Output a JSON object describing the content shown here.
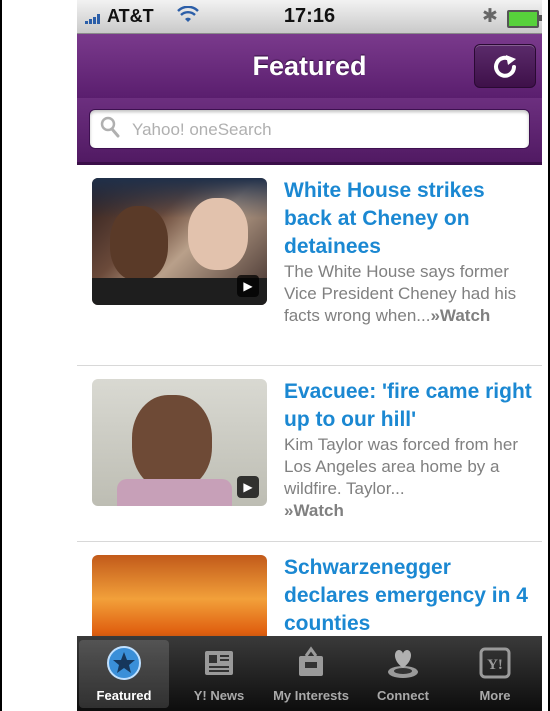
{
  "status_bar": {
    "carrier": "AT&T",
    "time": "17:16"
  },
  "nav": {
    "title": "Featured",
    "refresh_icon": "refresh-icon"
  },
  "search": {
    "placeholder": "Yahoo! oneSearch"
  },
  "articles": [
    {
      "headline": "White House strikes back at Cheney on detainees",
      "summary": "The White House says former Vice President Cheney had his facts wrong when...",
      "watch_label": "»Watch",
      "has_video": true
    },
    {
      "headline": "Evacuee: 'fire came right up to our hill'",
      "summary": "Kim Taylor was forced from her Los Angeles area home by a wildfire. Taylor...",
      "watch_label": "»Watch",
      "has_video": true
    },
    {
      "headline": "Schwarzenegger declares emergency in 4 counties",
      "summary": "",
      "watch_label": "",
      "has_video": false
    }
  ],
  "tabs": [
    {
      "label": "Featured",
      "icon": "star-icon",
      "active": true
    },
    {
      "label": "Y! News",
      "icon": "newspaper-icon",
      "active": false
    },
    {
      "label": "My Interests",
      "icon": "inbox-icon",
      "active": false
    },
    {
      "label": "Connect",
      "icon": "connect-icon",
      "active": false
    },
    {
      "label": "More",
      "icon": "yahoo-icon",
      "active": false
    }
  ],
  "colors": {
    "accent": "#5a1e6e",
    "headline": "#1b88d2"
  }
}
